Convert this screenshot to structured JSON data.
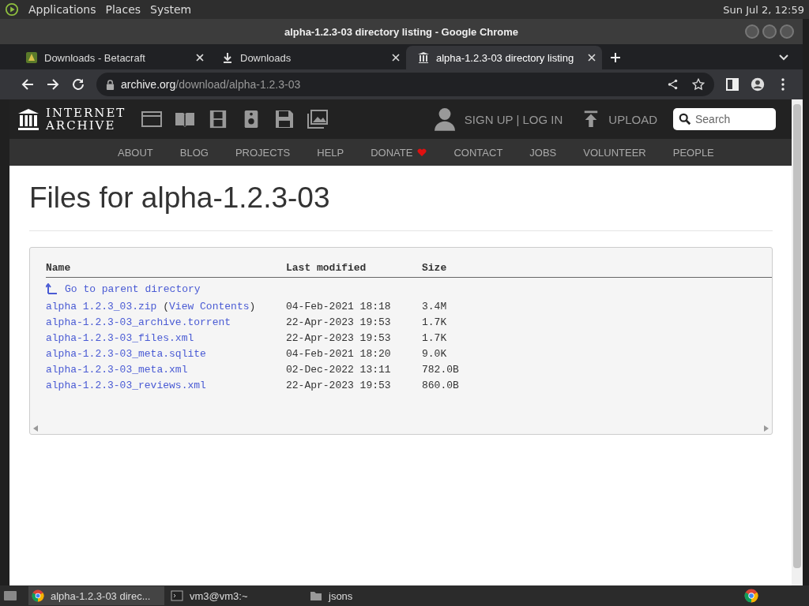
{
  "top_panel": {
    "menus": [
      "Applications",
      "Places",
      "System"
    ],
    "clock": "Sun Jul 2, 12:59"
  },
  "window": {
    "title": "alpha-1.2.3-03 directory listing - Google Chrome"
  },
  "tabs": [
    {
      "title": "Downloads - Betacraft",
      "kind": "favicon",
      "selected": false
    },
    {
      "title": "Downloads",
      "kind": "download",
      "selected": false
    },
    {
      "title": "alpha-1.2.3-03 directory listing",
      "kind": "archive",
      "selected": true
    }
  ],
  "address_bar": {
    "host": "archive.org",
    "path": "/download/alpha-1.2.3-03"
  },
  "site_header": {
    "logo_lines": [
      "INTERNET",
      "ARCHIVE"
    ],
    "account": "SIGN UP | LOG IN",
    "upload": "UPLOAD",
    "search": {
      "placeholder": "Search"
    }
  },
  "nav": [
    {
      "label": "ABOUT",
      "heart": false
    },
    {
      "label": "BLOG",
      "heart": false
    },
    {
      "label": "PROJECTS",
      "heart": false
    },
    {
      "label": "HELP",
      "heart": false
    },
    {
      "label": "DONATE",
      "heart": true
    },
    {
      "label": "CONTACT",
      "heart": false
    },
    {
      "label": "JOBS",
      "heart": false
    },
    {
      "label": "VOLUNTEER",
      "heart": false
    },
    {
      "label": "PEOPLE",
      "heart": false
    }
  ],
  "page": {
    "heading": "Files for alpha-1.2.3-03"
  },
  "table": {
    "columns": [
      "Name",
      "Last modified",
      "Size"
    ],
    "parent_link": "Go to parent directory",
    "rows": [
      {
        "name": "alpha 1.2.3_03.zip",
        "view_contents": {
          "open": "(",
          "label": "View Contents",
          "close": ")"
        },
        "modified": "04-Feb-2021 18:18",
        "size": "3.4M"
      },
      {
        "name": "alpha-1.2.3-03_archive.torrent",
        "modified": "22-Apr-2023 19:53",
        "size": "1.7K"
      },
      {
        "name": "alpha-1.2.3-03_files.xml",
        "modified": "22-Apr-2023 19:53",
        "size": "1.7K"
      },
      {
        "name": "alpha-1.2.3-03_meta.sqlite",
        "modified": "04-Feb-2021 18:20",
        "size": "9.0K"
      },
      {
        "name": "alpha-1.2.3-03_meta.xml",
        "modified": "02-Dec-2022 13:11",
        "size": "782.0B"
      },
      {
        "name": "alpha-1.2.3-03_reviews.xml",
        "modified": "22-Apr-2023 19:53",
        "size": "860.0B"
      }
    ]
  },
  "taskbar": {
    "items": [
      {
        "label": "alpha-1.2.3-03 direc...",
        "kind": "chrome",
        "selected": true
      },
      {
        "label": "vm3@vm3:~",
        "kind": "terminal",
        "selected": false
      },
      {
        "label": "jsons",
        "kind": "folder",
        "selected": false
      }
    ]
  }
}
